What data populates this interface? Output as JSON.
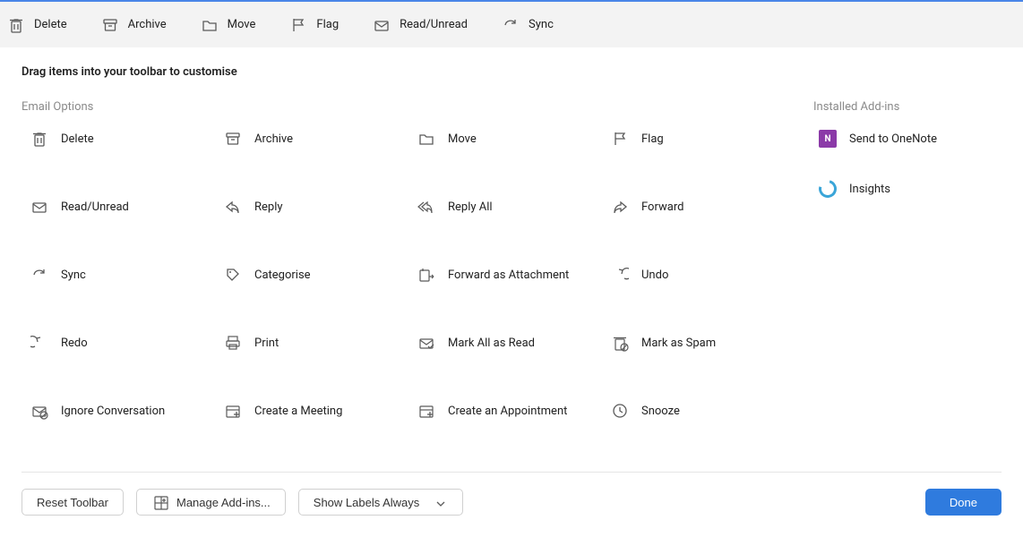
{
  "toolbar": {
    "items": [
      {
        "label": "Delete",
        "icon": "delete-icon"
      },
      {
        "label": "Archive",
        "icon": "archive-icon"
      },
      {
        "label": "Move",
        "icon": "move-icon"
      },
      {
        "label": "Flag",
        "icon": "flag-icon"
      },
      {
        "label": "Read/Unread",
        "icon": "read-unread-icon"
      },
      {
        "label": "Sync",
        "icon": "sync-icon"
      }
    ]
  },
  "instruction": "Drag items into your toolbar to customise",
  "sections": {
    "email_options_title": "Email Options",
    "addins_title": "Installed Add-ins"
  },
  "email_options": [
    {
      "label": "Delete",
      "icon": "delete-icon"
    },
    {
      "label": "Archive",
      "icon": "archive-icon"
    },
    {
      "label": "Move",
      "icon": "move-icon"
    },
    {
      "label": "Flag",
      "icon": "flag-icon"
    },
    {
      "label": "Read/Unread",
      "icon": "read-unread-icon"
    },
    {
      "label": "Reply",
      "icon": "reply-icon"
    },
    {
      "label": "Reply All",
      "icon": "reply-all-icon"
    },
    {
      "label": "Forward",
      "icon": "forward-icon"
    },
    {
      "label": "Sync",
      "icon": "sync-icon"
    },
    {
      "label": "Categorise",
      "icon": "categorise-icon"
    },
    {
      "label": "Forward as Attachment",
      "icon": "forward-attachment-icon"
    },
    {
      "label": "Undo",
      "icon": "undo-icon"
    },
    {
      "label": "Redo",
      "icon": "redo-icon"
    },
    {
      "label": "Print",
      "icon": "print-icon"
    },
    {
      "label": "Mark All as Read",
      "icon": "mark-all-read-icon"
    },
    {
      "label": "Mark as Spam",
      "icon": "mark-spam-icon"
    },
    {
      "label": "Ignore Conversation",
      "icon": "ignore-conversation-icon"
    },
    {
      "label": "Create a Meeting",
      "icon": "create-meeting-icon"
    },
    {
      "label": "Create an Appointment",
      "icon": "create-appointment-icon"
    },
    {
      "label": "Snooze",
      "icon": "snooze-icon"
    }
  ],
  "addins": [
    {
      "label": "Send to OneNote",
      "icon": "onenote-icon"
    },
    {
      "label": "Insights",
      "icon": "insights-icon"
    }
  ],
  "footer": {
    "reset": "Reset Toolbar",
    "manage_addins": "Manage Add-ins...",
    "show_labels": "Show Labels Always",
    "done": "Done"
  }
}
